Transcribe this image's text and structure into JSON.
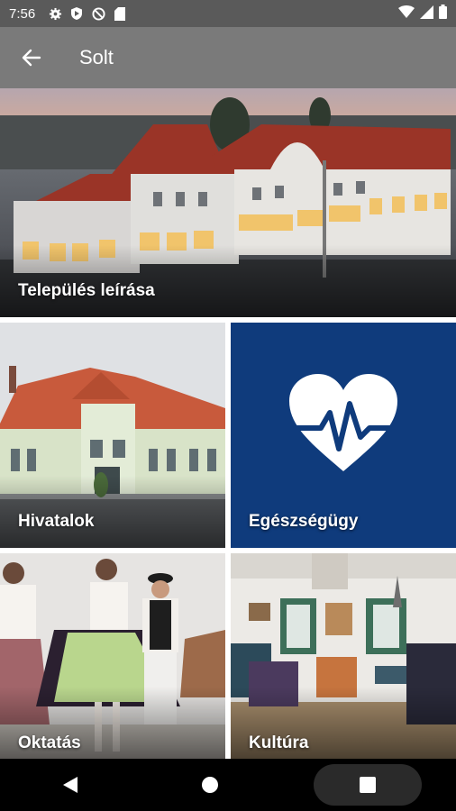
{
  "status_bar": {
    "time": "7:56",
    "icons": [
      "settings-icon",
      "shield-icon",
      "no-data-icon",
      "sd-card-icon",
      "wifi-icon",
      "signal-icon",
      "battery-icon"
    ]
  },
  "app_bar": {
    "title": "Solt",
    "back_icon": "arrow-left-icon"
  },
  "tiles": [
    {
      "label": "Település leírása",
      "image": "town-hall-photo"
    },
    {
      "label": "Hivatalok",
      "image": "office-building-photo"
    },
    {
      "label": "Egészségügy",
      "image": "heart-pulse-icon",
      "color": "#0f3b7c"
    },
    {
      "label": "Oktatás",
      "image": "folk-dancers-photo"
    },
    {
      "label": "Kultúra",
      "image": "folk-interior-photo"
    }
  ],
  "nav_bar": {
    "buttons": [
      "back-triangle-icon",
      "home-circle-icon",
      "recents-square-icon"
    ]
  }
}
